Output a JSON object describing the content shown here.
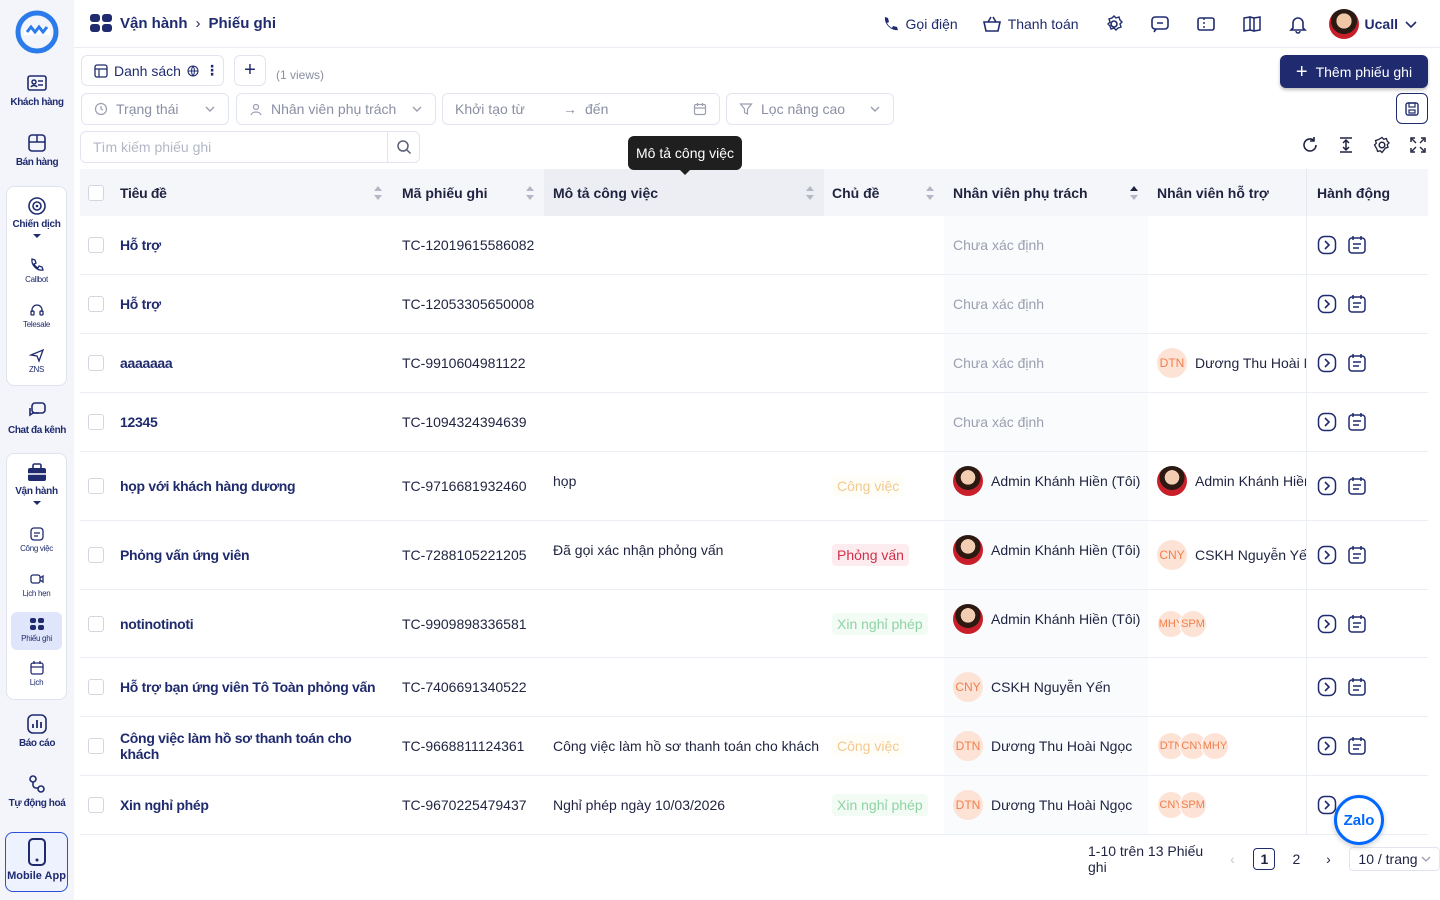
{
  "sidebar": {
    "items": {
      "customers": "Khách hàng",
      "sales": "Bán hàng",
      "campaign": "Chiến dịch",
      "callbot": "Callbot",
      "telesale": "Telesale",
      "zns": "ZNS",
      "omnichat": "Chat đa kênh",
      "operations": "Vận hành",
      "tasks": "Công việc",
      "appointments": "Lịch hẹn",
      "tickets": "Phiếu ghi",
      "calendar": "Lịch",
      "reports": "Báo cáo",
      "automation": "Tự động hoá",
      "mobile": "Mobile App"
    }
  },
  "header": {
    "breadcrumb": [
      "Vận hành",
      "Phiếu ghi"
    ],
    "call_label": "Gọi điện",
    "payment_label": "Thanh toán",
    "user_name": "Ucall"
  },
  "toolbar": {
    "view_tab": "Danh sách",
    "views_count": "(1 views)",
    "add_button": "Thêm phiếu ghi",
    "filter_status": "Trạng thái",
    "filter_staff": "Nhân viên phụ trách",
    "date_from": "Khởi tạo từ",
    "date_to": "đến",
    "advanced_filter": "Lọc nâng cao",
    "search_placeholder": "Tìm kiếm phiếu ghi",
    "tooltip": "Mô tả công việc"
  },
  "table": {
    "columns": [
      "Tiêu đề",
      "Mã phiếu ghi",
      "Mô tả công việc",
      "Chủ đề",
      "Nhân viên phụ trách",
      "Nhân viên hỗ trợ",
      "Hành động"
    ],
    "rows": [
      {
        "title": "Hỗ trợ",
        "code": "TC-12019615586082",
        "desc": "",
        "topic": "",
        "staff": "Chưa xác định",
        "support": ""
      },
      {
        "title": "Hỗ trợ",
        "code": "TC-12053305650008",
        "desc": "",
        "topic": "",
        "staff": "Chưa xác định",
        "support": ""
      },
      {
        "title": "aaaaaaa",
        "code": "TC-9910604981122",
        "desc": "",
        "topic": "",
        "staff": "Chưa xác định",
        "support_initials": "DTN",
        "support": "Dương Thu Hoài N"
      },
      {
        "title": "12345",
        "code": "TC-1094324394639",
        "desc": "",
        "topic": "",
        "staff": "Chưa xác định",
        "support": ""
      },
      {
        "title": "họp với khách hàng dương",
        "code": "TC-9716681932460",
        "desc": "họp",
        "topic": "Công việc",
        "staff": "Admin Khánh Hiền (Tôi)",
        "support": "Admin Khánh Hiền"
      },
      {
        "title": "Phỏng vấn ứng viên",
        "code": "TC-7288105221205",
        "desc": "Đã gọi xác nhận phỏng vấn",
        "topic": "Phỏng vấn",
        "staff": "Admin Khánh Hiền (Tôi)",
        "support_initials": "CNY",
        "support": "CSKH Nguyễn Yến"
      },
      {
        "title": "notinotinoti",
        "code": "TC-9909898336581",
        "desc": "",
        "topic": "Xin nghỉ phép",
        "staff": "Admin Khánh Hiền (Tôi)",
        "support_stack": [
          "MHY",
          "SPM"
        ]
      },
      {
        "title": "Hỗ trợ bạn ứng viên Tô Toàn phỏng vấn",
        "code": "TC-7406691340522",
        "desc": "",
        "topic": "",
        "staff_initials": "CNY",
        "staff": "CSKH Nguyễn Yến",
        "support": ""
      },
      {
        "title": "Công việc làm hồ sơ thanh toán cho khách",
        "code": "TC-9668811124361",
        "desc": "Công việc làm hồ sơ thanh toán cho khách",
        "topic": "Công việc",
        "staff_initials": "DTN",
        "staff": "Dương Thu Hoài Ngọc",
        "support_stack": [
          "DTN",
          "CNY",
          "MHY"
        ]
      },
      {
        "title": "Xin nghỉ phép",
        "code": "TC-9670225479437",
        "desc": "Nghỉ phép ngày 10/03/2026",
        "topic": "Xin nghỉ phép",
        "staff_initials": "DTN",
        "staff": "Dương Thu Hoài Ngọc",
        "support_stack": [
          "CNY",
          "SPM"
        ]
      }
    ]
  },
  "pagination": {
    "summary": "1-10 trên 13 Phiếu ghi",
    "pages": [
      "1",
      "2"
    ],
    "current": "1",
    "page_size": "10 / trang"
  },
  "zalo": "Zalo",
  "colors": {
    "primary": "#1f2b6e",
    "accent": "#2b4fd8"
  }
}
